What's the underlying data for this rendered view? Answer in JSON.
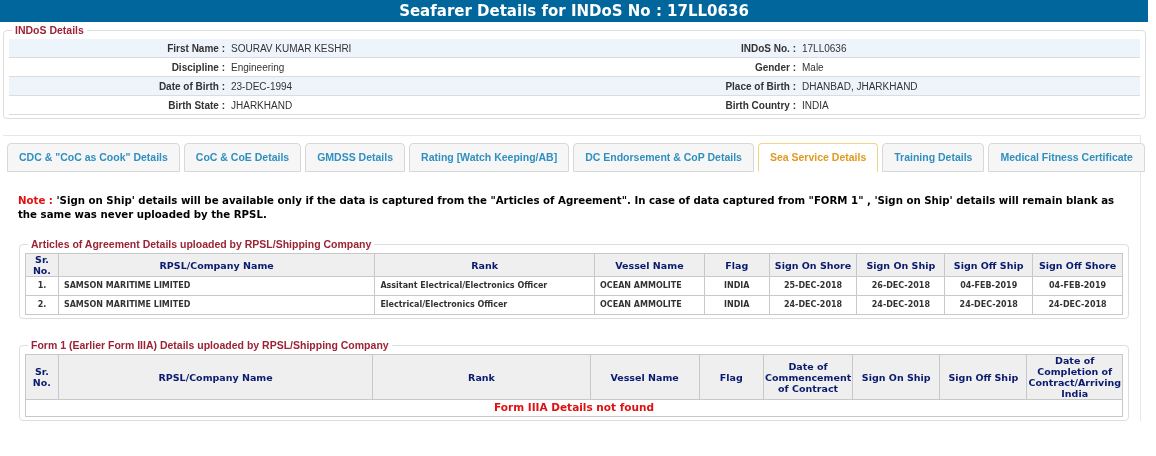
{
  "header": {
    "title": "Seafarer Details for INDoS No : 17LL0636"
  },
  "indos": {
    "legend": "INDoS Details",
    "rows": [
      {
        "left_label": "First Name :",
        "left_value": "SOURAV KUMAR KESHRI",
        "right_label": "INDoS No. :",
        "right_value": "17LL0636"
      },
      {
        "left_label": "Discipline :",
        "left_value": "Engineering",
        "right_label": "Gender :",
        "right_value": "Male"
      },
      {
        "left_label": "Date of Birth :",
        "left_value": "23-DEC-1994",
        "right_label": "Place of Birth :",
        "right_value": "DHANBAD, JHARKHAND"
      },
      {
        "left_label": "Birth State :",
        "left_value": "JHARKHAND",
        "right_label": "Birth Country :",
        "right_value": "INDIA"
      }
    ]
  },
  "tabs": [
    {
      "label": "CDC & \"CoC as Cook\" Details",
      "selected": false
    },
    {
      "label": "CoC & CoE Details",
      "selected": false
    },
    {
      "label": "GMDSS Details",
      "selected": false
    },
    {
      "label": "Rating [Watch Keeping/AB]",
      "selected": false
    },
    {
      "label": "DC Endorsement & CoP Details",
      "selected": false
    },
    {
      "label": "Sea Service Details",
      "selected": true
    },
    {
      "label": "Training Details",
      "selected": false
    },
    {
      "label": "Medical Fitness Certificate",
      "selected": false
    }
  ],
  "note": {
    "label": "Note :",
    "text": "'Sign on Ship' details will be available only if the data is captured from the \"Articles of Agreement\". In case of data captured from \"FORM 1\" , 'Sign on Ship' details will remain blank as the same was never uploaded by the RPSL."
  },
  "articles_table": {
    "legend": "Articles of Agreement Details uploaded by RPSL/Shipping Company",
    "columns": [
      "Sr. No.",
      "RPSL/Company Name",
      "Rank",
      "Vessel Name",
      "Flag",
      "Sign On Shore",
      "Sign On Ship",
      "Sign Off Ship",
      "Sign Off Shore"
    ],
    "rows": [
      [
        "1.",
        "SAMSON MARITIME LIMITED",
        "Assitant Electrical/Electronics Officer",
        "OCEAN AMMOLITE",
        "INDIA",
        "25-DEC-2018",
        "26-DEC-2018",
        "04-FEB-2019",
        "04-FEB-2019"
      ],
      [
        "2.",
        "SAMSON MARITIME LIMITED",
        "Electrical/Electronics Officer",
        "OCEAN AMMOLITE",
        "INDIA",
        "24-DEC-2018",
        "24-DEC-2018",
        "24-DEC-2018",
        "24-DEC-2018"
      ]
    ]
  },
  "form1_table": {
    "legend": "Form 1 (Earlier Form IIIA) Details uploaded by RPSL/Shipping Company",
    "columns": [
      "Sr. No.",
      "RPSL/Company Name",
      "Rank",
      "Vessel Name",
      "Flag",
      "Date of Commencement of Contract",
      "Sign On Ship",
      "Sign Off Ship",
      "Date of Completion of Contract/Arriving India"
    ],
    "empty_message": "Form IIIA Details not found"
  }
}
